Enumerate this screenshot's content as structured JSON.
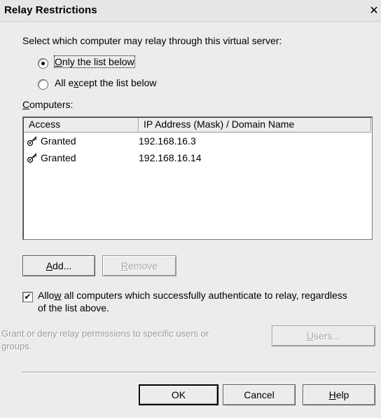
{
  "window": {
    "title": "Relay Restrictions",
    "close_glyph": "✕"
  },
  "selection": {
    "prompt": "Select which computer may relay through this virtual server:",
    "options": [
      {
        "label_prefix": "",
        "accel": "O",
        "label_rest": "nly the list below",
        "checked": true
      },
      {
        "label_prefix": "All e",
        "accel": "x",
        "label_rest": "cept the list below",
        "checked": false
      }
    ]
  },
  "computers": {
    "label_accel": "C",
    "label_rest": "omputers:",
    "columns": [
      "Access",
      "IP Address (Mask) / Domain Name"
    ],
    "rows": [
      {
        "access": "Granted",
        "ip": "192.168.16.3",
        "icon": "key-icon"
      },
      {
        "access": "Granted",
        "ip": "192.168.16.14",
        "icon": "key-icon"
      }
    ]
  },
  "buttons": {
    "add": {
      "accel": "A",
      "rest": "dd..."
    },
    "remove": {
      "accel": "R",
      "rest": "emove"
    },
    "users": {
      "accel": "U",
      "rest": "sers..."
    },
    "ok": "OK",
    "cancel": "Cancel",
    "help": {
      "accel": "H",
      "rest": "elp"
    }
  },
  "allow_auth": {
    "checked": true,
    "check_glyph": "✔",
    "line1_prefix": "Allo",
    "line1_accel": "w",
    "line1_rest": " all computers which successfully authenticate to relay, regardless",
    "line2": "of the list above."
  },
  "permissions": {
    "line1": "Grant or deny relay permissions to specific users or",
    "line2": "groups."
  }
}
